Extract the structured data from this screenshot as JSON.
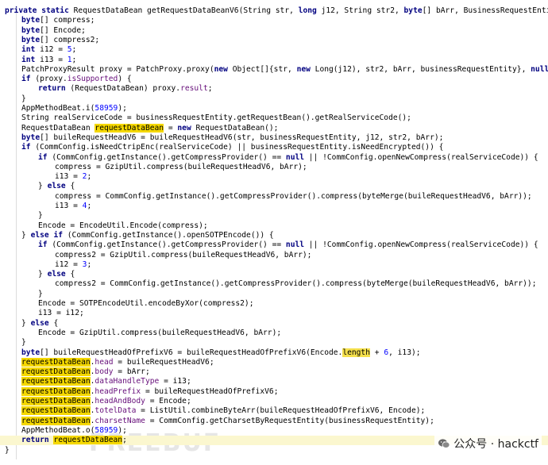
{
  "editor": {
    "lines": [
      {
        "indent": 1,
        "tokens": [
          {
            "t": "private static ",
            "c": "kw"
          },
          {
            "t": "RequestDataBean getRequestDataBeanV6(String str, "
          },
          {
            "t": "long",
            "c": "kw"
          },
          {
            "t": " j12, String str2, "
          },
          {
            "t": "byte",
            "c": "kw"
          },
          {
            "t": "[] bArr, BusinessRequestEntity b"
          }
        ]
      },
      {
        "indent": 2,
        "tokens": [
          {
            "t": "byte",
            "c": "kw"
          },
          {
            "t": "[] compress;"
          }
        ]
      },
      {
        "indent": 2,
        "tokens": [
          {
            "t": "byte",
            "c": "kw"
          },
          {
            "t": "[] Encode;"
          }
        ]
      },
      {
        "indent": 2,
        "tokens": [
          {
            "t": "byte",
            "c": "kw"
          },
          {
            "t": "[] compress2;"
          }
        ]
      },
      {
        "indent": 2,
        "tokens": [
          {
            "t": "int",
            "c": "kw"
          },
          {
            "t": " i12 = "
          },
          {
            "t": "5",
            "c": "num"
          },
          {
            "t": ";"
          }
        ]
      },
      {
        "indent": 2,
        "tokens": [
          {
            "t": "int",
            "c": "kw"
          },
          {
            "t": " i13 = "
          },
          {
            "t": "1",
            "c": "num"
          },
          {
            "t": ";"
          }
        ]
      },
      {
        "indent": 2,
        "tokens": [
          {
            "t": "PatchProxyResult proxy = PatchProxy.proxy("
          },
          {
            "t": "new",
            "c": "kw"
          },
          {
            "t": " Object[]{str, "
          },
          {
            "t": "new",
            "c": "kw"
          },
          {
            "t": " Long(j12), str2, bArr, businessRequestEntity}, "
          },
          {
            "t": "null",
            "c": "nul"
          },
          {
            "t": ", ch"
          }
        ]
      },
      {
        "indent": 2,
        "tokens": [
          {
            "t": "if",
            "c": "kw"
          },
          {
            "t": " (proxy."
          },
          {
            "t": "isSupported",
            "c": "fld"
          },
          {
            "t": ") {"
          }
        ]
      },
      {
        "indent": 3,
        "tokens": [
          {
            "t": "return",
            "c": "kw"
          },
          {
            "t": " (RequestDataBean) proxy."
          },
          {
            "t": "result",
            "c": "fld"
          },
          {
            "t": ";"
          }
        ]
      },
      {
        "indent": 2,
        "tokens": [
          {
            "t": "}"
          }
        ]
      },
      {
        "indent": 2,
        "tokens": [
          {
            "t": "AppMethodBeat.i("
          },
          {
            "t": "58959",
            "c": "num"
          },
          {
            "t": ");"
          }
        ]
      },
      {
        "indent": 2,
        "tokens": [
          {
            "t": "String realServiceCode = businessRequestEntity.getRequestBean().getRealServiceCode();"
          }
        ]
      },
      {
        "indent": 2,
        "tokens": [
          {
            "t": "RequestDataBean "
          },
          {
            "t": "requestDataBean",
            "c": "hl"
          },
          {
            "t": " = "
          },
          {
            "t": "new",
            "c": "kw"
          },
          {
            "t": " RequestDataBean();"
          }
        ]
      },
      {
        "indent": 2,
        "tokens": [
          {
            "t": "byte",
            "c": "kw"
          },
          {
            "t": "[] buileRequestHeadV6 = buileRequestHeadV6(str, businessRequestEntity, j12, str2, bArr);"
          }
        ]
      },
      {
        "indent": 2,
        "tokens": [
          {
            "t": "if",
            "c": "kw"
          },
          {
            "t": " (CommConfig.isNeedCtripEnc(realServiceCode) || businessRequestEntity.isNeedEncrypted()) {"
          }
        ]
      },
      {
        "indent": 3,
        "tokens": [
          {
            "t": "if",
            "c": "kw"
          },
          {
            "t": " (CommConfig.getInstance().getCompressProvider() == "
          },
          {
            "t": "null",
            "c": "nul"
          },
          {
            "t": " || !CommConfig.openNewCompress(realServiceCode)) {"
          }
        ]
      },
      {
        "indent": 4,
        "tokens": [
          {
            "t": "compress = GzipUtil.compress(buileRequestHeadV6, bArr);"
          }
        ]
      },
      {
        "indent": 4,
        "tokens": [
          {
            "t": "i13 = "
          },
          {
            "t": "2",
            "c": "num"
          },
          {
            "t": ";"
          }
        ]
      },
      {
        "indent": 3,
        "tokens": [
          {
            "t": "} "
          },
          {
            "t": "else",
            "c": "kw"
          },
          {
            "t": " {"
          }
        ]
      },
      {
        "indent": 4,
        "tokens": [
          {
            "t": "compress = CommConfig.getInstance().getCompressProvider().compress(byteMerge(buileRequestHeadV6, bArr));"
          }
        ]
      },
      {
        "indent": 4,
        "tokens": [
          {
            "t": "i13 = "
          },
          {
            "t": "4",
            "c": "num"
          },
          {
            "t": ";"
          }
        ]
      },
      {
        "indent": 3,
        "tokens": [
          {
            "t": "}"
          }
        ]
      },
      {
        "indent": 3,
        "tokens": [
          {
            "t": "Encode = EncodeUtil.Encode(compress);"
          }
        ]
      },
      {
        "indent": 2,
        "tokens": [
          {
            "t": "} "
          },
          {
            "t": "else if",
            "c": "kw"
          },
          {
            "t": " (CommConfig.getInstance().openSOTPEncode()) {"
          }
        ]
      },
      {
        "indent": 3,
        "tokens": [
          {
            "t": "if",
            "c": "kw"
          },
          {
            "t": " (CommConfig.getInstance().getCompressProvider() == "
          },
          {
            "t": "null",
            "c": "nul"
          },
          {
            "t": " || !CommConfig.openNewCompress(realServiceCode)) {"
          }
        ]
      },
      {
        "indent": 4,
        "tokens": [
          {
            "t": "compress2 = GzipUtil.compress(buileRequestHeadV6, bArr);"
          }
        ]
      },
      {
        "indent": 4,
        "tokens": [
          {
            "t": "i12 = "
          },
          {
            "t": "3",
            "c": "num"
          },
          {
            "t": ";"
          }
        ]
      },
      {
        "indent": 3,
        "tokens": [
          {
            "t": "} "
          },
          {
            "t": "else",
            "c": "kw"
          },
          {
            "t": " {"
          }
        ]
      },
      {
        "indent": 4,
        "tokens": [
          {
            "t": "compress2 = CommConfig.getInstance().getCompressProvider().compress(byteMerge(buileRequestHeadV6, bArr));"
          }
        ]
      },
      {
        "indent": 3,
        "tokens": [
          {
            "t": "}"
          }
        ]
      },
      {
        "indent": 3,
        "tokens": [
          {
            "t": "Encode = SOTPEncodeUtil.encodeByXor(compress2);"
          }
        ]
      },
      {
        "indent": 3,
        "tokens": [
          {
            "t": "i13 = i12;"
          }
        ]
      },
      {
        "indent": 2,
        "tokens": [
          {
            "t": "} "
          },
          {
            "t": "else",
            "c": "kw"
          },
          {
            "t": " {"
          }
        ]
      },
      {
        "indent": 3,
        "tokens": [
          {
            "t": "Encode = GzipUtil.compress(buileRequestHeadV6, bArr);"
          }
        ]
      },
      {
        "indent": 2,
        "tokens": [
          {
            "t": "}"
          }
        ]
      },
      {
        "indent": 2,
        "tokens": [
          {
            "t": "byte",
            "c": "kw"
          },
          {
            "t": "[] buileRequestHeadOfPrefixV6 = buileRequestHeadOfPrefixV6(Encode."
          },
          {
            "t": "length",
            "c": "hl2"
          },
          {
            "t": " + "
          },
          {
            "t": "6",
            "c": "num"
          },
          {
            "t": ", i13);"
          }
        ]
      },
      {
        "indent": 2,
        "tokens": [
          {
            "t": "requestDataBean",
            "c": "hl"
          },
          {
            "t": "."
          },
          {
            "t": "head",
            "c": "fld"
          },
          {
            "t": " = buileRequestHeadV6;"
          }
        ]
      },
      {
        "indent": 2,
        "tokens": [
          {
            "t": "requestDataBean",
            "c": "hl"
          },
          {
            "t": "."
          },
          {
            "t": "body",
            "c": "fld"
          },
          {
            "t": " = bArr;"
          }
        ]
      },
      {
        "indent": 2,
        "tokens": [
          {
            "t": "requestDataBean",
            "c": "hl"
          },
          {
            "t": "."
          },
          {
            "t": "dataHandleType",
            "c": "fld"
          },
          {
            "t": " = i13;"
          }
        ]
      },
      {
        "indent": 2,
        "tokens": [
          {
            "t": "requestDataBean",
            "c": "hl"
          },
          {
            "t": "."
          },
          {
            "t": "headPrefix",
            "c": "fld"
          },
          {
            "t": " = buileRequestHeadOfPrefixV6;"
          }
        ]
      },
      {
        "indent": 2,
        "tokens": [
          {
            "t": "requestDataBean",
            "c": "hl"
          },
          {
            "t": "."
          },
          {
            "t": "headAndBody",
            "c": "fld"
          },
          {
            "t": " = Encode;"
          }
        ]
      },
      {
        "indent": 2,
        "tokens": [
          {
            "t": "requestDataBean",
            "c": "hl"
          },
          {
            "t": "."
          },
          {
            "t": "totelData",
            "c": "fld"
          },
          {
            "t": " = ListUtil.combineByteArr(buileRequestHeadOfPrefixV6, Encode);"
          }
        ]
      },
      {
        "indent": 2,
        "tokens": [
          {
            "t": "requestDataBean",
            "c": "hl"
          },
          {
            "t": "."
          },
          {
            "t": "charsetName",
            "c": "fld"
          },
          {
            "t": " = CommConfig.getCharsetByRequestEntity(businessRequestEntity);"
          }
        ]
      },
      {
        "indent": 2,
        "tokens": [
          {
            "t": "AppMethodBeat.o("
          },
          {
            "t": "58959",
            "c": "num"
          },
          {
            "t": ");"
          }
        ]
      },
      {
        "indent": 2,
        "current": true,
        "tokens": [
          {
            "t": "return",
            "c": "kw"
          },
          {
            "t": " "
          },
          {
            "t": "requestDataBean",
            "c": "hl"
          },
          {
            "t": ";"
          }
        ]
      },
      {
        "indent": 1,
        "tokens": [
          {
            "t": "}"
          }
        ]
      }
    ]
  },
  "watermark": {
    "icon": "wechat-icon",
    "label": "公众号 · hackctf",
    "bg_logo": "FREEBUF"
  },
  "colors": {
    "keyword": "#000080",
    "number": "#0000ff",
    "field": "#660e7a",
    "highlight": "#f5d800",
    "current_line": "#fbf7cf"
  }
}
